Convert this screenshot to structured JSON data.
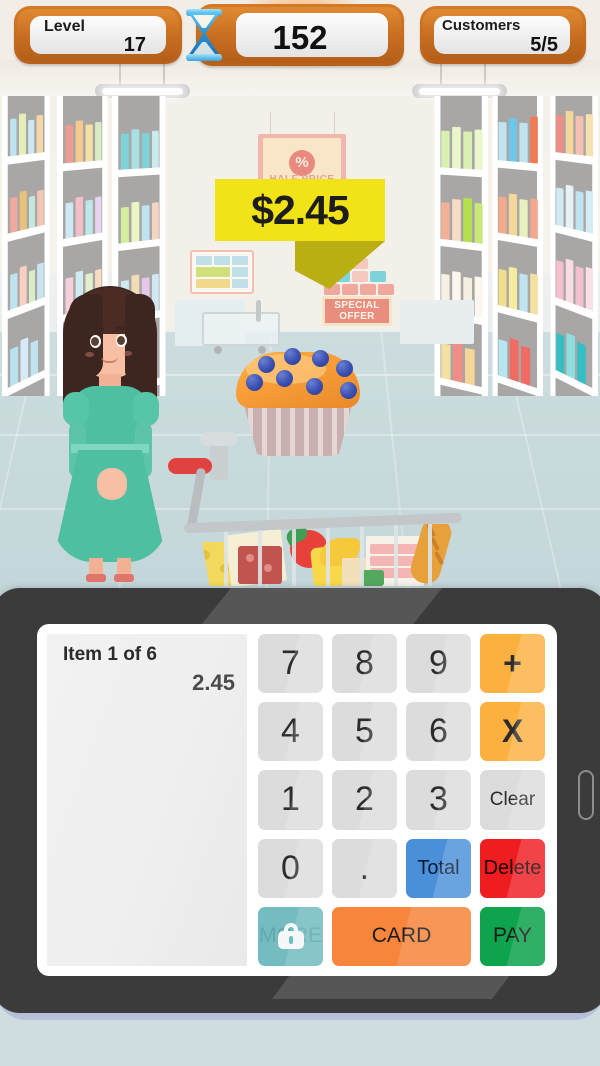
{
  "hud": {
    "level": {
      "label": "Level",
      "value": "17",
      "icon": "level-panel"
    },
    "timer": {
      "value": "152",
      "icon": "hourglass-icon"
    },
    "customers": {
      "label": "Customers",
      "value": "5/5"
    }
  },
  "scene": {
    "price_bubble": "$2.45",
    "half_price_banner": {
      "symbol": "%",
      "text": "HALF PRICE"
    },
    "special_offer_sign": {
      "line1": "SPECIAL",
      "line2": "OFFER"
    },
    "product": "blueberry-muffin",
    "character": "cashier-girl"
  },
  "pos": {
    "receipt": {
      "item_counter": "Item 1 of 6",
      "price": "2.45"
    },
    "keys": [
      {
        "label": "7",
        "type": "digit"
      },
      {
        "label": "8",
        "type": "digit"
      },
      {
        "label": "9",
        "type": "digit"
      },
      {
        "label": "+",
        "type": "op"
      },
      {
        "label": "4",
        "type": "digit"
      },
      {
        "label": "5",
        "type": "digit"
      },
      {
        "label": "6",
        "type": "digit"
      },
      {
        "label": "X",
        "type": "op"
      },
      {
        "label": "1",
        "type": "digit"
      },
      {
        "label": "2",
        "type": "digit"
      },
      {
        "label": "3",
        "type": "digit"
      },
      {
        "label": "Clear",
        "type": "small"
      },
      {
        "label": "0",
        "type": "digit"
      },
      {
        "label": ".",
        "type": "dot"
      },
      {
        "label": "Total",
        "type": "total"
      },
      {
        "label": "Delete",
        "type": "delete"
      }
    ],
    "actions": [
      {
        "label": "MORE",
        "state": "locked",
        "icon": "lock-icon"
      },
      {
        "label": "CARD",
        "state": "enabled"
      },
      {
        "label": "PAY",
        "state": "enabled"
      }
    ]
  },
  "colors": {
    "hud_wood": "#c96f21",
    "price_bubble": "#f2e318",
    "op_key": "#fbb03f",
    "total_key": "#4a90d9",
    "delete_key": "#ef1c20",
    "more_key": "#74bcc0",
    "card_key": "#f7853c",
    "pay_key": "#0ea34d",
    "dress": "#4fbfa2",
    "floor": "#c7d9dc"
  }
}
